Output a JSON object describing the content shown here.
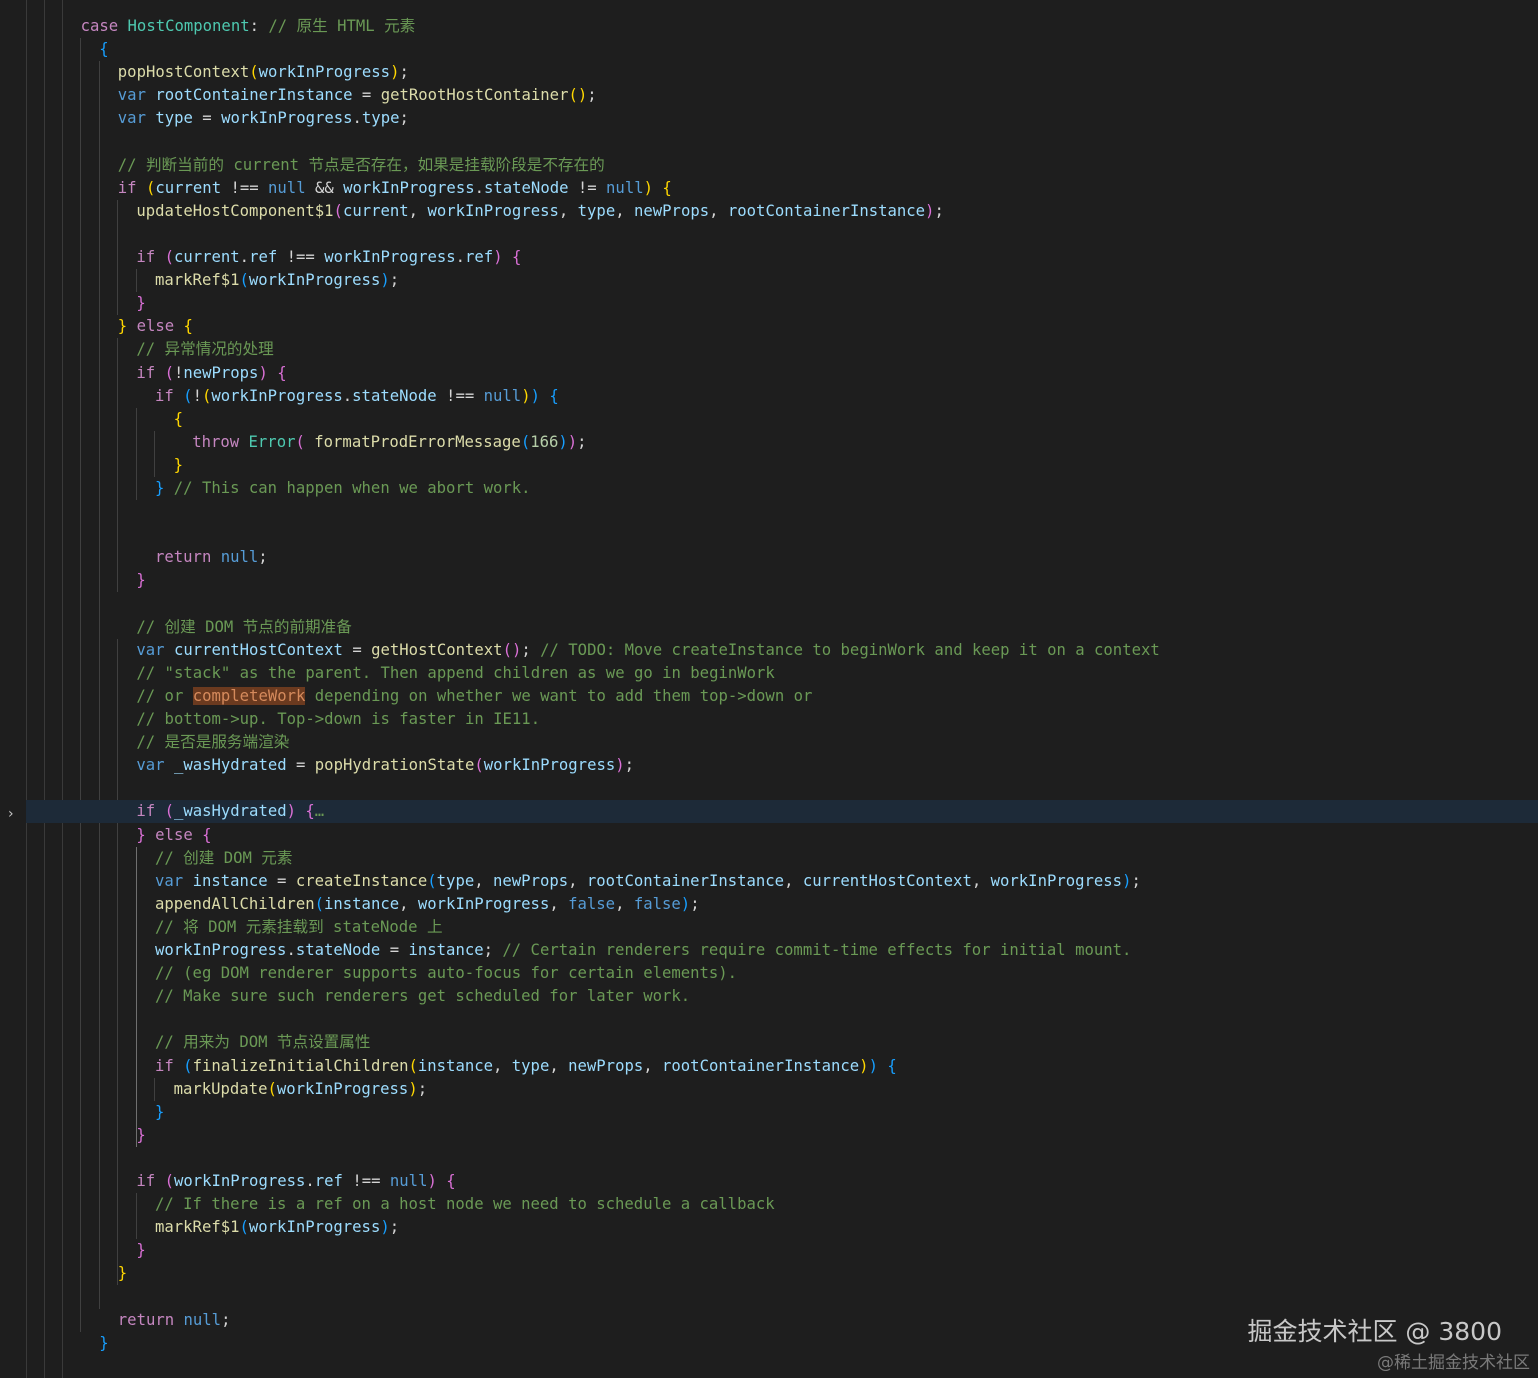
{
  "editor": {
    "theme_colors": {
      "background": "#1e1e1e",
      "keyword": "#c586c0",
      "storage": "#569cd6",
      "function": "#dcdcaa",
      "variable": "#9cdcfe",
      "type": "#4ec9b0",
      "number": "#b5cea8",
      "comment": "#6a9955",
      "string": "#ce9178",
      "punctuation": "#d4d4d4",
      "bracket1": "#ffd700",
      "bracket2": "#da70d6",
      "bracket3": "#179fff"
    },
    "lines": [
      [
        [
          "keyword",
          "case "
        ],
        [
          "type",
          "HostComponent"
        ],
        [
          "punct",
          ": "
        ],
        [
          "comment",
          "// 原生 HTML 元素"
        ]
      ],
      [
        [
          "bracket3",
          "{"
        ]
      ],
      [
        [
          "function",
          "popHostContext"
        ],
        [
          "bracket1",
          "("
        ],
        [
          "variable",
          "workInProgress"
        ],
        [
          "bracket1",
          ")"
        ],
        [
          "punct",
          ";"
        ]
      ],
      [
        [
          "storage",
          "var "
        ],
        [
          "variable",
          "rootContainerInstance"
        ],
        [
          "punct",
          " = "
        ],
        [
          "function",
          "getRootHostContainer"
        ],
        [
          "bracket1",
          "()"
        ],
        [
          "punct",
          ";"
        ]
      ],
      [
        [
          "storage",
          "var "
        ],
        [
          "variable",
          "type"
        ],
        [
          "punct",
          " = "
        ],
        [
          "variable",
          "workInProgress"
        ],
        [
          "punct",
          "."
        ],
        [
          "variable",
          "type"
        ],
        [
          "punct",
          ";"
        ]
      ],
      [],
      [
        [
          "comment",
          "// 判断当前的 current 节点是否存在，如果是挂载阶段是不存在的"
        ]
      ],
      [
        [
          "keyword",
          "if "
        ],
        [
          "bracket1",
          "("
        ],
        [
          "variable",
          "current"
        ],
        [
          "punct",
          " !== "
        ],
        [
          "storage",
          "null"
        ],
        [
          "punct",
          " && "
        ],
        [
          "variable",
          "workInProgress"
        ],
        [
          "punct",
          "."
        ],
        [
          "variable",
          "stateNode"
        ],
        [
          "punct",
          " != "
        ],
        [
          "storage",
          "null"
        ],
        [
          "bracket1",
          ")"
        ],
        [
          "punct",
          " "
        ],
        [
          "bracket1",
          "{"
        ]
      ],
      [
        [
          "function",
          "updateHostComponent$1"
        ],
        [
          "bracket2",
          "("
        ],
        [
          "variable",
          "current"
        ],
        [
          "punct",
          ", "
        ],
        [
          "variable",
          "workInProgress"
        ],
        [
          "punct",
          ", "
        ],
        [
          "variable",
          "type"
        ],
        [
          "punct",
          ", "
        ],
        [
          "variable",
          "newProps"
        ],
        [
          "punct",
          ", "
        ],
        [
          "variable",
          "rootContainerInstance"
        ],
        [
          "bracket2",
          ")"
        ],
        [
          "punct",
          ";"
        ]
      ],
      [],
      [
        [
          "keyword",
          "if "
        ],
        [
          "bracket2",
          "("
        ],
        [
          "variable",
          "current"
        ],
        [
          "punct",
          "."
        ],
        [
          "variable",
          "ref"
        ],
        [
          "punct",
          " !== "
        ],
        [
          "variable",
          "workInProgress"
        ],
        [
          "punct",
          "."
        ],
        [
          "variable",
          "ref"
        ],
        [
          "bracket2",
          ")"
        ],
        [
          "punct",
          " "
        ],
        [
          "bracket2",
          "{"
        ]
      ],
      [
        [
          "function",
          "markRef$1"
        ],
        [
          "bracket3",
          "("
        ],
        [
          "variable",
          "workInProgress"
        ],
        [
          "bracket3",
          ")"
        ],
        [
          "punct",
          ";"
        ]
      ],
      [
        [
          "bracket2",
          "}"
        ]
      ],
      [
        [
          "bracket1",
          "}"
        ],
        [
          "keyword",
          " else "
        ],
        [
          "bracket1",
          "{"
        ]
      ],
      [
        [
          "comment",
          "// 异常情况的处理"
        ]
      ],
      [
        [
          "keyword",
          "if "
        ],
        [
          "bracket2",
          "("
        ],
        [
          "punct",
          "!"
        ],
        [
          "variable",
          "newProps"
        ],
        [
          "bracket2",
          ")"
        ],
        [
          "punct",
          " "
        ],
        [
          "bracket2",
          "{"
        ]
      ],
      [
        [
          "keyword",
          "if "
        ],
        [
          "bracket3",
          "("
        ],
        [
          "punct",
          "!"
        ],
        [
          "bracket1",
          "("
        ],
        [
          "variable",
          "workInProgress"
        ],
        [
          "punct",
          "."
        ],
        [
          "variable",
          "stateNode"
        ],
        [
          "punct",
          " !== "
        ],
        [
          "storage",
          "null"
        ],
        [
          "bracket1",
          ")"
        ],
        [
          "bracket3",
          ")"
        ],
        [
          "punct",
          " "
        ],
        [
          "bracket3",
          "{"
        ]
      ],
      [
        [
          "bracket1",
          "{"
        ]
      ],
      [
        [
          "keyword",
          "throw "
        ],
        [
          "type",
          "Error"
        ],
        [
          "bracket2",
          "("
        ],
        [
          "punct",
          " "
        ],
        [
          "function",
          "formatProdErrorMessage"
        ],
        [
          "bracket3",
          "("
        ],
        [
          "number",
          "166"
        ],
        [
          "bracket3",
          ")"
        ],
        [
          "bracket2",
          ")"
        ],
        [
          "punct",
          ";"
        ]
      ],
      [
        [
          "bracket1",
          "}"
        ]
      ],
      [
        [
          "bracket3",
          "}"
        ],
        [
          "punct",
          " "
        ],
        [
          "comment",
          "// This can happen when we abort work."
        ]
      ],
      [],
      [],
      [
        [
          "keyword",
          "return "
        ],
        [
          "storage",
          "null"
        ],
        [
          "punct",
          ";"
        ]
      ],
      [
        [
          "bracket2",
          "}"
        ]
      ],
      [],
      [
        [
          "comment",
          "// 创建 DOM 节点的前期准备"
        ]
      ],
      [
        [
          "storage",
          "var "
        ],
        [
          "variable",
          "currentHostContext"
        ],
        [
          "punct",
          " = "
        ],
        [
          "function",
          "getHostContext"
        ],
        [
          "bracket2",
          "()"
        ],
        [
          "punct",
          "; "
        ],
        [
          "comment",
          "// TODO: Move createInstance to beginWork and keep it on a context"
        ]
      ],
      [
        [
          "comment",
          "// \"stack\" as the parent. Then append children as we go in beginWork"
        ]
      ],
      [
        [
          "comment",
          "// or "
        ],
        [
          "highlight",
          "completeWork"
        ],
        [
          "comment",
          " depending on whether we want to add them top->down or"
        ]
      ],
      [
        [
          "comment",
          "// bottom->up. Top->down is faster in IE11."
        ]
      ],
      [
        [
          "comment",
          "// 是否是服务端渲染"
        ]
      ],
      [
        [
          "storage",
          "var "
        ],
        [
          "variable",
          "_wasHydrated"
        ],
        [
          "punct",
          " = "
        ],
        [
          "function",
          "popHydrationState"
        ],
        [
          "bracket2",
          "("
        ],
        [
          "variable",
          "workInProgress"
        ],
        [
          "bracket2",
          ")"
        ],
        [
          "punct",
          ";"
        ]
      ],
      [],
      [
        [
          "keyword",
          "if "
        ],
        [
          "bracket2",
          "("
        ],
        [
          "variable",
          "_wasHydrated"
        ],
        [
          "bracket2",
          ")"
        ],
        [
          "punct",
          " "
        ],
        [
          "bracket2",
          "{"
        ],
        [
          "comment",
          "…"
        ]
      ],
      [
        [
          "bracket2",
          "}"
        ],
        [
          "keyword",
          " else "
        ],
        [
          "bracket2",
          "{"
        ]
      ],
      [
        [
          "comment",
          "// 创建 DOM 元素"
        ]
      ],
      [
        [
          "storage",
          "var "
        ],
        [
          "variable",
          "instance"
        ],
        [
          "punct",
          " = "
        ],
        [
          "function",
          "createInstance"
        ],
        [
          "bracket3",
          "("
        ],
        [
          "variable",
          "type"
        ],
        [
          "punct",
          ", "
        ],
        [
          "variable",
          "newProps"
        ],
        [
          "punct",
          ", "
        ],
        [
          "variable",
          "rootContainerInstance"
        ],
        [
          "punct",
          ", "
        ],
        [
          "variable",
          "currentHostContext"
        ],
        [
          "punct",
          ", "
        ],
        [
          "variable",
          "workInProgress"
        ],
        [
          "bracket3",
          ")"
        ],
        [
          "punct",
          ";"
        ]
      ],
      [
        [
          "function",
          "appendAllChildren"
        ],
        [
          "bracket3",
          "("
        ],
        [
          "variable",
          "instance"
        ],
        [
          "punct",
          ", "
        ],
        [
          "variable",
          "workInProgress"
        ],
        [
          "punct",
          ", "
        ],
        [
          "storage",
          "false"
        ],
        [
          "punct",
          ", "
        ],
        [
          "storage",
          "false"
        ],
        [
          "bracket3",
          ")"
        ],
        [
          "punct",
          ";"
        ]
      ],
      [
        [
          "comment",
          "// 将 DOM 元素挂载到 stateNode 上"
        ]
      ],
      [
        [
          "variable",
          "workInProgress"
        ],
        [
          "punct",
          "."
        ],
        [
          "variable",
          "stateNode"
        ],
        [
          "punct",
          " = "
        ],
        [
          "variable",
          "instance"
        ],
        [
          "punct",
          "; "
        ],
        [
          "comment",
          "// Certain renderers require commit-time effects for initial mount."
        ]
      ],
      [
        [
          "comment",
          "// (eg DOM renderer supports auto-focus for certain elements)."
        ]
      ],
      [
        [
          "comment",
          "// Make sure such renderers get scheduled for later work."
        ]
      ],
      [],
      [
        [
          "comment",
          "// 用来为 DOM 节点设置属性"
        ]
      ],
      [
        [
          "keyword",
          "if "
        ],
        [
          "bracket3",
          "("
        ],
        [
          "function",
          "finalizeInitialChildren"
        ],
        [
          "bracket1",
          "("
        ],
        [
          "variable",
          "instance"
        ],
        [
          "punct",
          ", "
        ],
        [
          "variable",
          "type"
        ],
        [
          "punct",
          ", "
        ],
        [
          "variable",
          "newProps"
        ],
        [
          "punct",
          ", "
        ],
        [
          "variable",
          "rootContainerInstance"
        ],
        [
          "bracket1",
          ")"
        ],
        [
          "bracket3",
          ")"
        ],
        [
          "punct",
          " "
        ],
        [
          "bracket3",
          "{"
        ]
      ],
      [
        [
          "function",
          "markUpdate"
        ],
        [
          "bracket1",
          "("
        ],
        [
          "variable",
          "workInProgress"
        ],
        [
          "bracket1",
          ")"
        ],
        [
          "punct",
          ";"
        ]
      ],
      [
        [
          "bracket3",
          "}"
        ]
      ],
      [
        [
          "bracket2",
          "}"
        ]
      ],
      [],
      [
        [
          "keyword",
          "if "
        ],
        [
          "bracket2",
          "("
        ],
        [
          "variable",
          "workInProgress"
        ],
        [
          "punct",
          "."
        ],
        [
          "variable",
          "ref"
        ],
        [
          "punct",
          " !== "
        ],
        [
          "storage",
          "null"
        ],
        [
          "bracket2",
          ")"
        ],
        [
          "punct",
          " "
        ],
        [
          "bracket2",
          "{"
        ]
      ],
      [
        [
          "comment",
          "// If there is a ref on a host node we need to schedule a callback"
        ]
      ],
      [
        [
          "function",
          "markRef$1"
        ],
        [
          "bracket3",
          "("
        ],
        [
          "variable",
          "workInProgress"
        ],
        [
          "bracket3",
          ")"
        ],
        [
          "punct",
          ";"
        ]
      ],
      [
        [
          "bracket2",
          "}"
        ]
      ],
      [
        [
          "bracket1",
          "}"
        ]
      ],
      [],
      [
        [
          "keyword",
          "return "
        ],
        [
          "storage",
          "null"
        ],
        [
          "punct",
          ";"
        ]
      ],
      [
        [
          "bracket3",
          "}"
        ]
      ]
    ],
    "fold_marker_icon": "chevron-right-icon",
    "fold_marker": "›"
  },
  "watermark": {
    "main": "掘金技术社区 @ 3800",
    "sub": "@稀土掘金技术社区"
  }
}
